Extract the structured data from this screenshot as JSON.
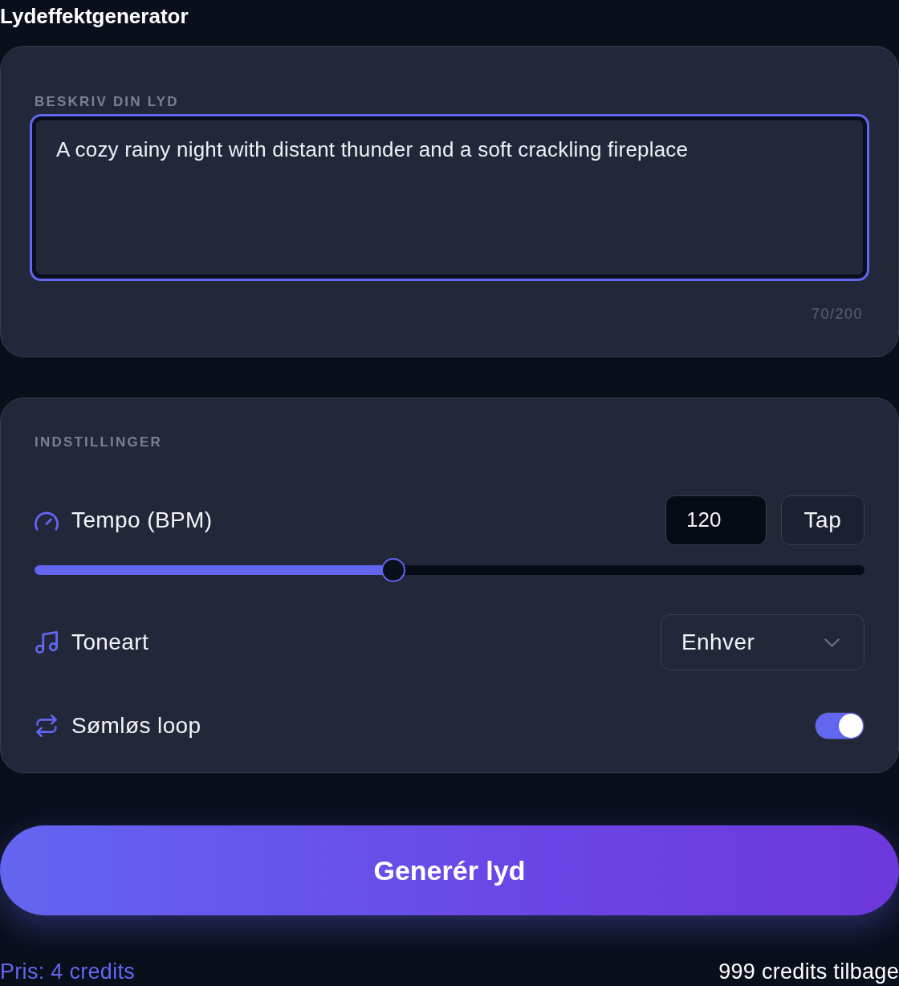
{
  "title": "Lydeffektgenerator",
  "prompt": {
    "label": "BESKRIV DIN LYD",
    "value": "A cozy rainy night with distant thunder and a soft crackling fireplace",
    "focused": true,
    "counter": "70/200"
  },
  "settings": {
    "heading": "INDSTILLINGER",
    "rows": [
      {
        "kind": "slider",
        "label": "Tempo (BPM)",
        "value": "120",
        "button": "Tap",
        "level": 0.43
      },
      {
        "kind": "select",
        "label": "Toneart",
        "value": "Enhver"
      },
      {
        "kind": "toggle",
        "label": "Sømløs loop",
        "on": true
      }
    ]
  },
  "generate": "Generér lyd",
  "footer": {
    "price": "Pris: 4 credits",
    "balance": "999 credits tilbage"
  }
}
